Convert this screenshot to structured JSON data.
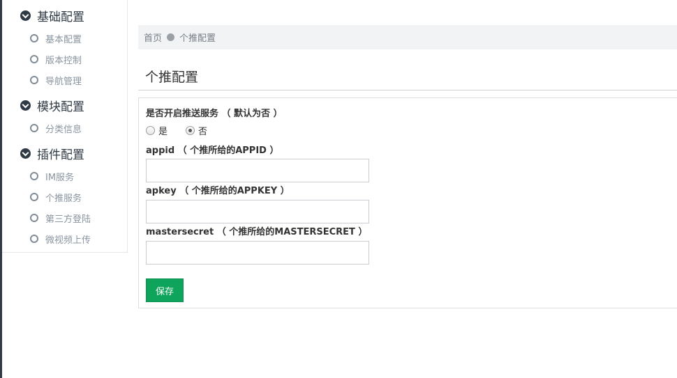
{
  "sidebar": {
    "groups": [
      {
        "label": "基础配置",
        "items": [
          "基本配置",
          "版本控制",
          "导航管理"
        ]
      },
      {
        "label": "模块配置",
        "items": [
          "分类信息"
        ]
      },
      {
        "label": "插件配置",
        "items": [
          "IM服务",
          "个推服务",
          "第三方登陆",
          "微视频上传"
        ]
      }
    ]
  },
  "breadcrumb": {
    "home": "首页",
    "current": "个推配置"
  },
  "page_title": "个推配置",
  "form": {
    "push_label": "是否开启推送服务 （ 默认为否 ）",
    "radio_yes": "是",
    "radio_no": "否",
    "selected": "否",
    "appid_label": "appid （ 个推所给的APPID ）",
    "appid_value": "",
    "apkey_label": "apkey （ 个推所给的APPKEY ）",
    "apkey_value": "",
    "master_label": "mastersecret （ 个推所给的MASTERSECRET ）",
    "master_value": "",
    "save_label": "保存"
  },
  "colors": {
    "accent": "#0fa45b",
    "sidebar_text": "#8a95a0",
    "dark": "#2f3a45"
  }
}
